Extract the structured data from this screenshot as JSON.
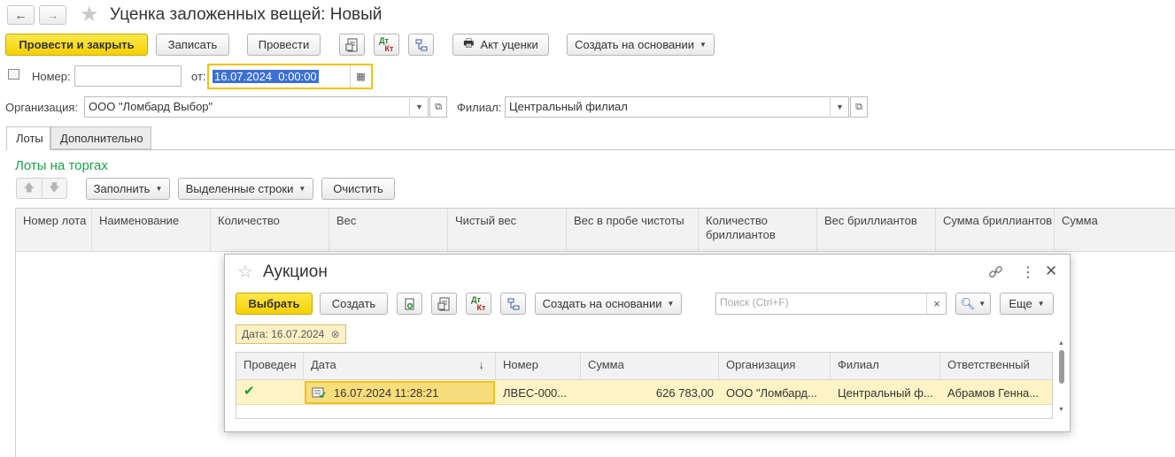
{
  "window": {
    "title": "Уценка заложенных вещей: Новый",
    "back_glyph": "←",
    "forward_glyph": "→",
    "star_glyph": "★"
  },
  "toolbar": {
    "post_and_close": "Провести и закрыть",
    "save": "Записать",
    "post": "Провести",
    "dt_kt_top": "Дт",
    "dt_kt_bottom": "Кт",
    "act_label": "Акт уценки",
    "create_based_on": "Создать на основании"
  },
  "header": {
    "number_label": "Номер:",
    "number_value": "",
    "from_label": "от:",
    "date_value": "16.07.2024  0:00:00",
    "org_label": "Организация:",
    "org_value": "ООО \"Ломбард Выбор\"",
    "branch_label": "Филиал:",
    "branch_value": "Центральный филиал"
  },
  "tabs": [
    {
      "label": "Лоты"
    },
    {
      "label": "Дополнительно"
    }
  ],
  "lots": {
    "section_title": "Лоты на торгах",
    "fill_btn": "Заполнить",
    "selected_rows_btn": "Выделенные строки",
    "clear_btn": "Очистить",
    "columns": [
      "Номер лота",
      "Наименование",
      "Количество",
      "Вес",
      "Чистый вес",
      "Вес в пробе чистоты",
      "Количество бриллиантов",
      "Вес бриллиантов",
      "Сумма бриллиантов",
      "Сумма"
    ]
  },
  "popup": {
    "title": "Аукцион",
    "star_glyph": "☆",
    "link_glyph": "🔗",
    "more_glyph": "⋮",
    "close_glyph": "✕",
    "select_btn": "Выбрать",
    "create_btn": "Создать",
    "dt_kt_top": "Дт",
    "dt_kt_bottom": "Кт",
    "create_based_on": "Создать на основании",
    "search_placeholder": "Поиск (Ctrl+F)",
    "search_clear": "×",
    "more_btn": "Еще",
    "filter_tag": "Дата: 16.07.2024",
    "filter_tag_close": "⊗",
    "columns": [
      "Проведен",
      "Дата",
      "Номер",
      "Сумма",
      "Организация",
      "Филиал",
      "Ответственный"
    ],
    "sort_glyph": "↓",
    "rows": [
      {
        "posted": "✔",
        "date": "16.07.2024 11:28:21",
        "number": "ЛВЕС-000...",
        "sum": "626 783,00",
        "org": "ООО \"Ломбард...",
        "branch": "Центральный ф...",
        "responsible": "Абрамов Генна..."
      }
    ]
  },
  "colors": {
    "accent_yellow": "#f5d000",
    "section_green": "#17a34a",
    "selected_row": "#fdf3c4",
    "date_highlight": "#3b6fd4",
    "focus_border": "#f3c300"
  }
}
